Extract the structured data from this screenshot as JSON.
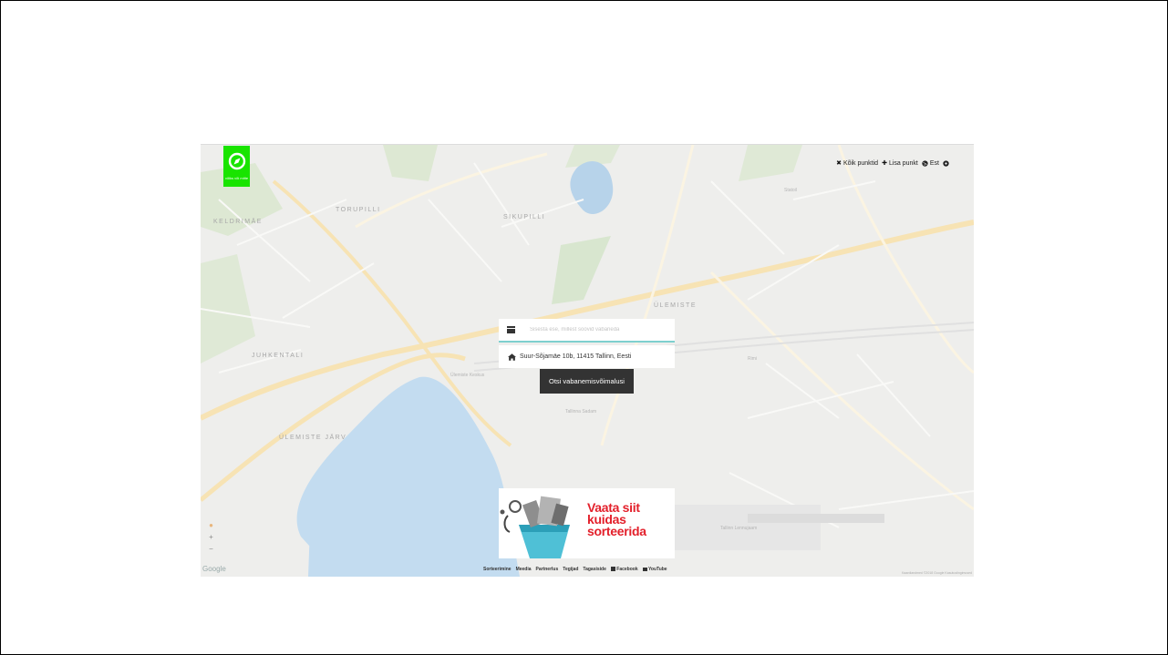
{
  "logo": {
    "text": "võiks või mitte"
  },
  "topnav": {
    "items": [
      {
        "icon": "close-icon",
        "label": "Kõik punktid"
      },
      {
        "icon": "plus-icon",
        "label": "Lisa punkt"
      },
      {
        "icon": "globe-icon",
        "label": "Est"
      },
      {
        "icon": "gear-icon",
        "label": ""
      }
    ]
  },
  "map": {
    "labels": [
      "KELDRIMÄE",
      "TORUPILLI",
      "SIKUPILLI",
      "JUHKENTALI",
      "ÜLEMISTE",
      "ÜLEMISTE JÄRV"
    ],
    "pois": [
      "Ülemiste Keskus",
      "Tallinna Sadam",
      "Tallinn Lennujaam",
      "Statoil",
      "Rimi"
    ]
  },
  "search": {
    "placeholder": "Sisesta ese, millest soovid vabaneda",
    "address": "Suur-Sõjamäe 10b, 11415 Tallinn, Eesti",
    "button_label": "Otsi vabanemisvõimalusi"
  },
  "banner": {
    "line1": "Vaata siit",
    "line2": "kuidas",
    "line3": "sorteerida"
  },
  "footer": {
    "links": [
      "Sorteerimine",
      "Meedia",
      "Partnerlus",
      "Tegijad",
      "Tagasiside",
      "Facebook",
      "YouTube"
    ]
  },
  "google": {
    "wordmark": "Google",
    "terms": "Kaardiandmed ©2018 Google   Kasutustingimused"
  },
  "zoom": {
    "plus": "+",
    "minus": "−"
  },
  "colors": {
    "brand": "#19e400",
    "accent": "#7ed0cf",
    "button": "#333333",
    "banner_red": "#e3202b"
  }
}
